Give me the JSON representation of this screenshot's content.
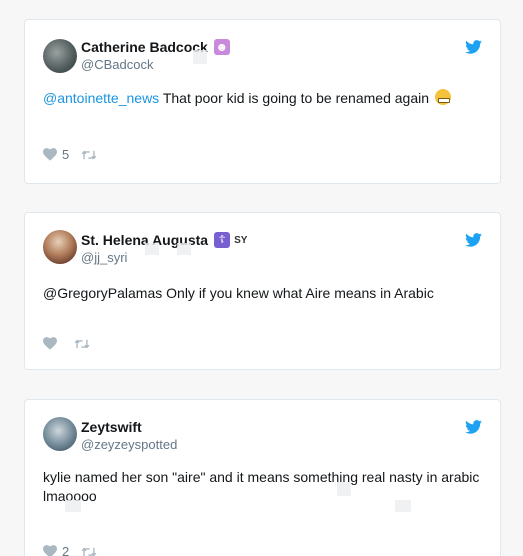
{
  "colors": {
    "mention": "#1b95e0",
    "twitter_blue": "#1da1f2",
    "muted": "#657786",
    "action_icon": "#aab8c2"
  },
  "tweets": [
    {
      "display_name": "Catherine Badcock",
      "badge": "woman-gesturing-emoji",
      "handle": "@CBadcock",
      "mention": "@antoinette_news",
      "text": " That poor kid is going to be renamed again",
      "trailing_emoji": "grimacing-face-emoji",
      "likes": "5",
      "retweets": ""
    },
    {
      "display_name": "St. Helena Augusta",
      "badge": "orthodox-cross-emoji",
      "badge_text": "SY",
      "handle": "@jj_syri",
      "mention": "",
      "text": "@GregoryPalamas Only if you knew what Aire means in Arabic",
      "likes": "",
      "retweets": ""
    },
    {
      "display_name": "Zeytswift",
      "handle": "@zeyzeyspotted",
      "mention": "",
      "text": "kylie named her son \"aire\" and it means something real nasty in arabic lmaoooo",
      "likes": "2",
      "retweets": ""
    }
  ]
}
